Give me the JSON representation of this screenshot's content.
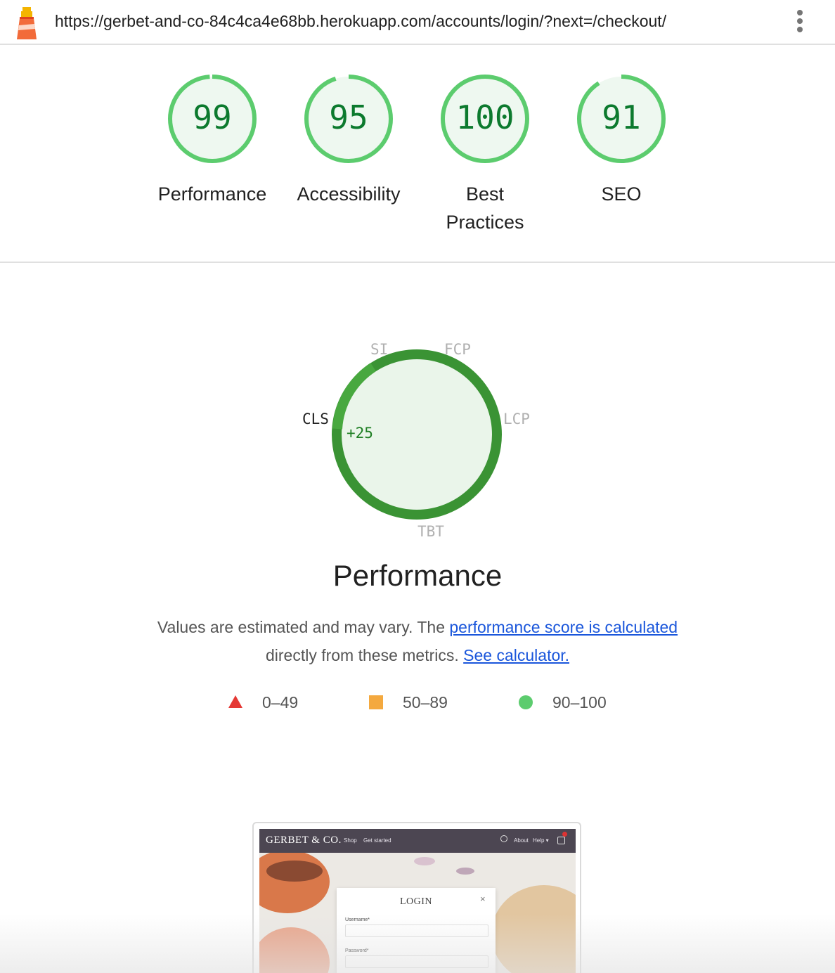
{
  "browser": {
    "url": "https://gerbet-and-co-84c4ca4e68bb.herokuapp.com/accounts/login/?next=/checkout/",
    "logo_icon": "lighthouse-icon",
    "menu_icon": "kebab-menu-icon"
  },
  "scores": [
    {
      "value": "99",
      "label": "Performance",
      "score": 99
    },
    {
      "value": "95",
      "label": "Accessibility",
      "score": 95
    },
    {
      "value": "100",
      "label": "Best Practices",
      "score": 100
    },
    {
      "value": "91",
      "label": "SEO",
      "score": 91
    }
  ],
  "performance_gauge": {
    "metrics": {
      "si": "SI",
      "fcp": "FCP",
      "lcp": "LCP",
      "tbt": "TBT",
      "cls": "CLS"
    },
    "active_metric": "CLS",
    "delta": "+25"
  },
  "section_title": "Performance",
  "description": {
    "text_before": "Values are estimated and may vary. The",
    "link1": "performance score is calculated",
    "text_middle": "directly from these metrics.",
    "link2": "See calculator."
  },
  "legend": [
    {
      "range": "0–49",
      "icon": "fail-triangle-icon",
      "color": "#e53935"
    },
    {
      "range": "50–89",
      "icon": "average-square-icon",
      "color": "#f4a93f"
    },
    {
      "range": "90–100",
      "icon": "pass-circle-icon",
      "color": "#5ccc6e"
    }
  ],
  "preview": {
    "brand": "GERBET & CO.",
    "nav": [
      "Shop",
      "Get started"
    ],
    "nav_right": [
      "About",
      "Help ▾"
    ],
    "modal_title": "LOGIN",
    "modal_close": "×",
    "fields": [
      "Username*",
      "Password*"
    ]
  },
  "colors": {
    "pass": "#0c7a2e",
    "pass_ring": "#5ccc6e",
    "pass_fill": "#eef8f0",
    "link": "#1a56db"
  }
}
